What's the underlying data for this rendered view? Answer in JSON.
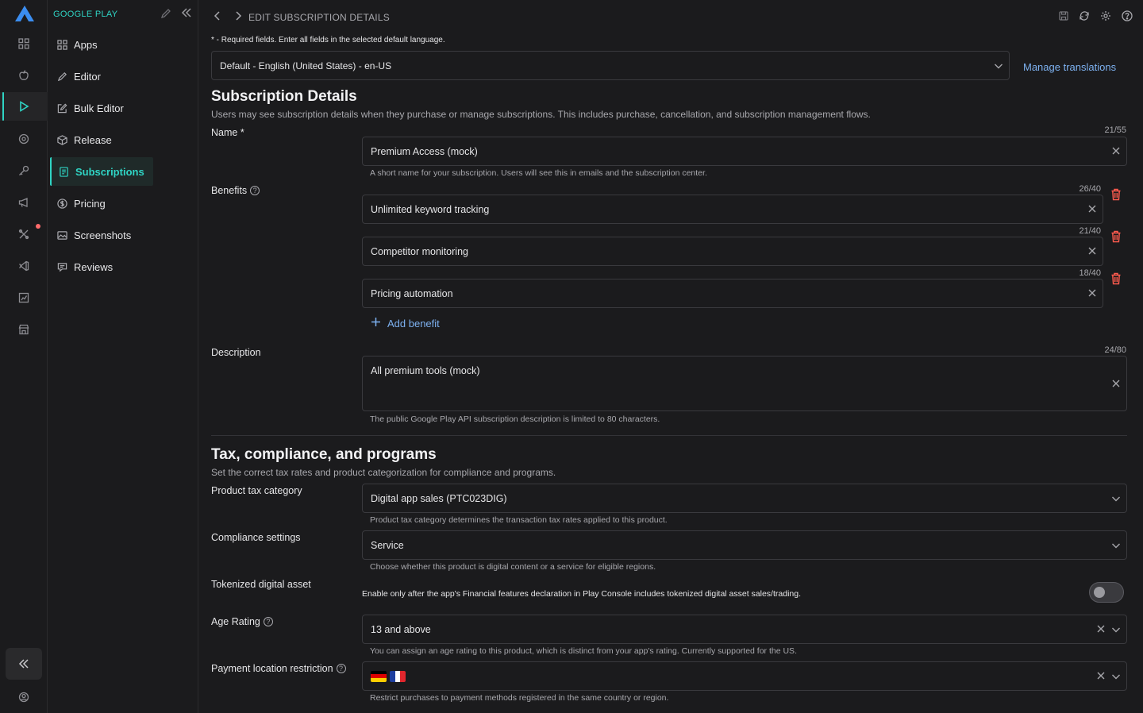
{
  "app": {
    "platform_title": "GOOGLE PLAY"
  },
  "rail": {
    "icons": [
      "grid-icon",
      "apple-icon",
      "play-icon",
      "target-icon",
      "key-icon",
      "megaphone-icon",
      "tools-icon",
      "vscode-icon",
      "chart-icon",
      "store-icon"
    ]
  },
  "sidebar": {
    "items": [
      {
        "label": "Apps",
        "icon": "grid-icon"
      },
      {
        "label": "Editor",
        "icon": "pencil-icon"
      },
      {
        "label": "Bulk Editor",
        "icon": "edit-square-icon"
      },
      {
        "label": "Release",
        "icon": "box-icon"
      },
      {
        "label": "Subscriptions",
        "icon": "document-icon"
      },
      {
        "label": "Pricing",
        "icon": "dollar-icon"
      },
      {
        "label": "Screenshots",
        "icon": "image-icon"
      },
      {
        "label": "Reviews",
        "icon": "review-icon"
      }
    ]
  },
  "header": {
    "breadcrumb": "EDIT SUBSCRIPTION DETAILS"
  },
  "form": {
    "required_note": "* - Required fields. Enter all fields in the selected default language.",
    "language": "Default - English (United States) - en-US",
    "manage_translations": "Manage translations",
    "details": {
      "title": "Subscription Details",
      "subtitle": "Users may see subscription details when they purchase or manage subscriptions. This includes purchase, cancellation, and subscription management flows.",
      "name_label": "Name *",
      "name_counter": "21/55",
      "name_value": "Premium Access (mock)",
      "name_helper": "A short name for your subscription. Users will see this in emails and the subscription center.",
      "benefits_label": "Benefits",
      "benefits": [
        {
          "counter": "26/40",
          "value": "Unlimited keyword tracking"
        },
        {
          "counter": "21/40",
          "value": "Competitor monitoring"
        },
        {
          "counter": "18/40",
          "value": "Pricing automation"
        }
      ],
      "add_benefit": "Add benefit",
      "description_label": "Description",
      "description_counter": "24/80",
      "description_value": "All premium tools (mock)",
      "description_helper": "The public Google Play API subscription description is limited to 80 characters."
    },
    "tax": {
      "title": "Tax, compliance, and programs",
      "subtitle": "Set the correct tax rates and product categorization for compliance and programs.",
      "category_label": "Product tax category",
      "category_value": "Digital app sales (PTC023DIG)",
      "category_helper": "Product tax category determines the transaction tax rates applied to this product.",
      "compliance_label": "Compliance settings",
      "compliance_value": "Service",
      "compliance_helper": "Choose whether this product is digital content or a service for eligible regions.",
      "token_label": "Tokenized digital asset",
      "token_text": "Enable only after the app's Financial features declaration in Play Console includes tokenized digital asset sales/trading.",
      "token_enabled": false,
      "age_label": "Age Rating",
      "age_value": "13 and above",
      "age_helper": "You can assign an age rating to this product, which is distinct from your app's rating. Currently supported for the US.",
      "payment_label": "Payment location restriction",
      "payment_flags": [
        "germany-flag",
        "france-flag"
      ],
      "payment_helper": "Restrict purchases to payment methods registered in the same country or region."
    }
  },
  "colors": {
    "accent": "#2fd4c4",
    "link": "#7db1f0",
    "danger": "#ff5b4e",
    "background": "#1b1b1d"
  }
}
